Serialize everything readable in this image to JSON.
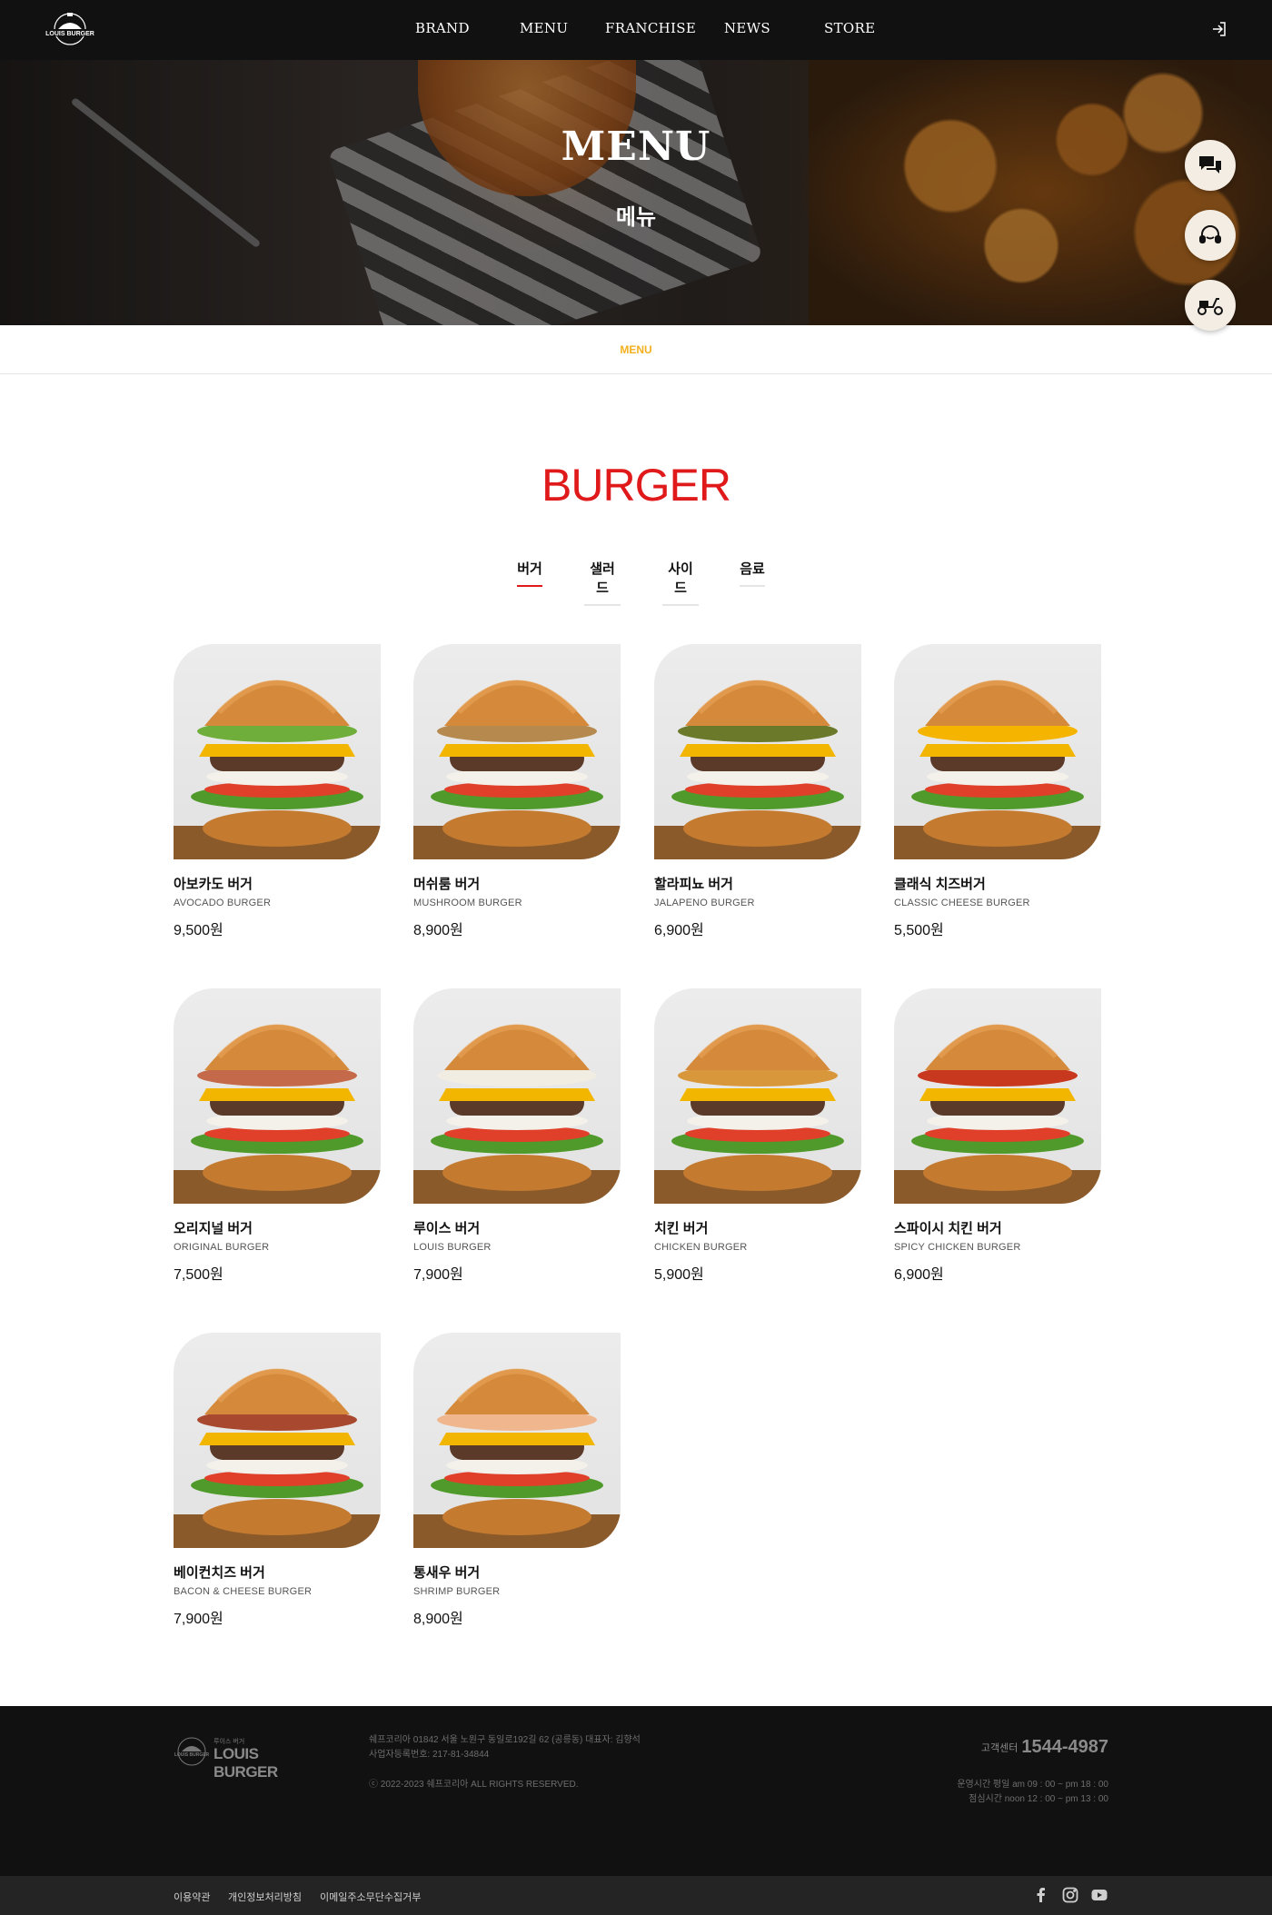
{
  "header": {
    "logo_text": "LOUIS BURGER",
    "nav": [
      "BRAND",
      "MENU",
      "FRANCHISE",
      "NEWS",
      "STORE"
    ]
  },
  "hero": {
    "title": "MENU",
    "subtitle": "메뉴"
  },
  "quick_buttons": [
    "chat-icon",
    "headset-icon",
    "scooter-icon"
  ],
  "subnav": {
    "active": "MENU"
  },
  "section": {
    "title": "BURGER"
  },
  "tabs": [
    {
      "label": "버거",
      "active": true
    },
    {
      "label": "샐러드",
      "active": false
    },
    {
      "label": "사이드",
      "active": false
    },
    {
      "label": "음료",
      "active": false
    }
  ],
  "products": [
    {
      "name": "아보카도 버거",
      "eng": "AVOCADO BURGER",
      "price": "9,500원",
      "topping": "#6fae3a"
    },
    {
      "name": "머쉬룸 버거",
      "eng": "MUSHROOM BURGER",
      "price": "8,900원",
      "topping": "#b68a4e"
    },
    {
      "name": "할라피뇨 버거",
      "eng": "JALAPENO BURGER",
      "price": "6,900원",
      "topping": "#6b7a2a"
    },
    {
      "name": "클래식 치즈버거",
      "eng": "CLASSIC CHEESE BURGER",
      "price": "5,500원",
      "topping": "#f5b400"
    },
    {
      "name": "오리지널 버거",
      "eng": "ORIGINAL BURGER",
      "price": "7,500원",
      "topping": "#c46a4a"
    },
    {
      "name": "루이스 버거",
      "eng": "LOUIS BURGER",
      "price": "7,900원",
      "topping": "#f1ede2"
    },
    {
      "name": "치킨 버거",
      "eng": "CHICKEN BURGER",
      "price": "5,900원",
      "topping": "#d8973a"
    },
    {
      "name": "스파이시 치킨 버거",
      "eng": "SPICY CHICKEN BURGER",
      "price": "6,900원",
      "topping": "#c8381e"
    },
    {
      "name": "베이컨치즈 버거",
      "eng": "BACON & CHEESE BURGER",
      "price": "7,900원",
      "topping": "#a8482e"
    },
    {
      "name": "통새우 버거",
      "eng": "SHRIMP BURGER",
      "price": "8,900원",
      "topping": "#f0b78f"
    }
  ],
  "footer": {
    "logo_text": "LOUIS BURGER",
    "logo_small": "루이스 버거",
    "address": "쉐프코리아 01842 서울 노원구 동일로192길 62 (공릉동) 대표자: 김향석",
    "biz_no": "사업자등록번호: 217-81-34844",
    "copyright": "ⓒ 2022-2023 쉐프코리아 ALL RIGHTS RESERVED.",
    "cs_label": "고객센터",
    "cs_number": "1544-4987",
    "hours_1": "운영시간 평일 am 09 : 00 ~ pm 18 : 00",
    "hours_2": "점심시간 noon 12 : 00 ~ pm 13 : 00",
    "links": [
      "이용약관",
      "개인정보처리방침",
      "이메일주소무단수집거부"
    ],
    "social": [
      "facebook-icon",
      "instagram-icon",
      "youtube-icon"
    ]
  }
}
